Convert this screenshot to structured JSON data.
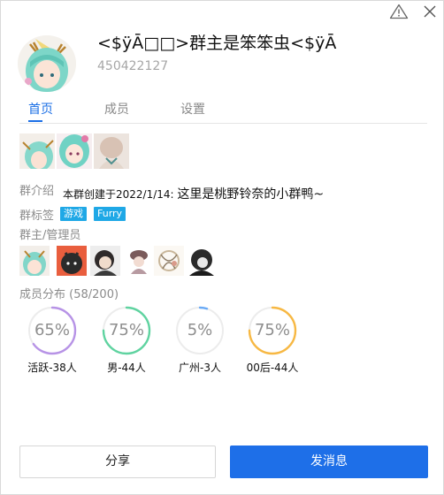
{
  "header": {
    "title": "<$ÿĀ□□>群主是笨笨虫<$ÿĀ",
    "group_id": "450422127",
    "warn_icon": "warning-triangle-icon",
    "close_icon": "close-icon"
  },
  "tabs": [
    {
      "label": "首页",
      "active": true
    },
    {
      "label": "成员",
      "active": false
    },
    {
      "label": "设置",
      "active": false
    }
  ],
  "intro": {
    "label": "群介绍",
    "prefix": "本群创建于2022/1/14:",
    "text": "这里是桃野铃奈的小群鸭~"
  },
  "tags": {
    "label": "群标签",
    "items": [
      "游戏",
      "Furry"
    ]
  },
  "admins": {
    "label": "群主/管理员"
  },
  "distribution": {
    "label": "成员分布",
    "count": "(58/200)",
    "stats": [
      {
        "value": "65%",
        "percent": 65,
        "label": "活跃-38人",
        "color": "#b793e6"
      },
      {
        "value": "75%",
        "percent": 75,
        "label": "男-44人",
        "color": "#5fd3a0"
      },
      {
        "value": "5%",
        "percent": 5,
        "label": "广州-3人",
        "color": "#6aaaf5"
      },
      {
        "value": "75%",
        "percent": 75,
        "label": "00后-44人",
        "color": "#f7b843"
      }
    ]
  },
  "buttons": {
    "share": "分享",
    "send": "发消息"
  },
  "colors": {
    "accent": "#1e6fe8",
    "tag": "#1fa8e6"
  }
}
